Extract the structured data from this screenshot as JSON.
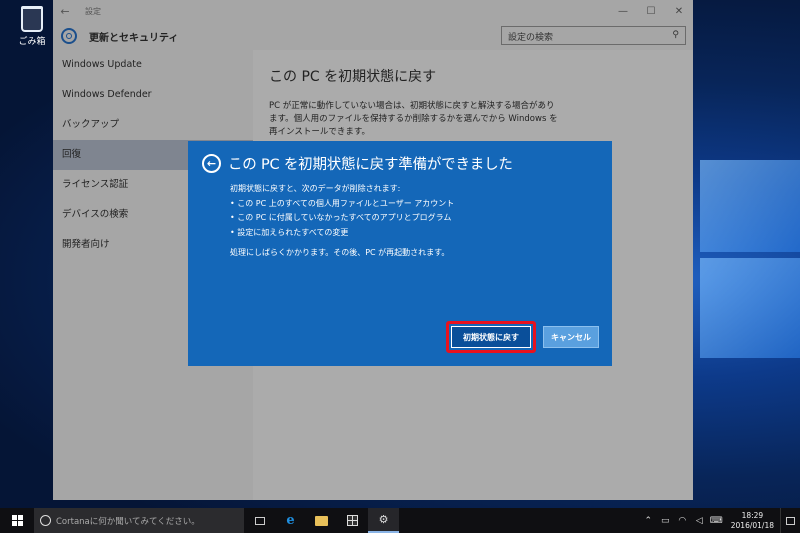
{
  "desktop": {
    "recycle_bin_label": "ごみ箱"
  },
  "settings_window": {
    "title": "設定",
    "back_glyph": "←",
    "min_glyph": "—",
    "max_glyph": "☐",
    "close_glyph": "✕",
    "header_title": "更新とセキュリティ",
    "search_placeholder": "設定の検索",
    "search_icon_glyph": "⚲",
    "sidebar": {
      "items": [
        {
          "label": "Windows Update"
        },
        {
          "label": "Windows Defender"
        },
        {
          "label": "バックアップ"
        },
        {
          "label": "回復"
        },
        {
          "label": "ライセンス認証"
        },
        {
          "label": "デバイスの検索"
        },
        {
          "label": "開発者向け"
        }
      ]
    },
    "content": {
      "title": "この PC を初期状態に戻す",
      "description": "PC が正常に動作していない場合は、初期状態に戻すと解決する場合があります。個人用のファイルを保持するか削除するかを選んでから Windows を再インストールできます。"
    }
  },
  "dialog": {
    "back_glyph": "←",
    "title": "この PC を初期状態に戻す準備ができました",
    "intro": "初期状態に戻すと、次のデータが削除されます:",
    "bullets": [
      "この PC 上のすべての個人用ファイルとユーザー アカウント",
      "この PC に付属していなかったすべてのアプリとプログラム",
      "設定に加えられたすべての変更"
    ],
    "note": "処理にしばらくかかります。その後、PC が再起動されます。",
    "reset_button": "初期状態に戻す",
    "cancel_button": "キャンセル",
    "highlight_color": "#e8121f"
  },
  "taskbar": {
    "cortana_placeholder": "Cortanaに何か聞いてみてください。",
    "edge_glyph": "e",
    "settings_glyph": "⚙",
    "tray_up_glyph": "⌃",
    "tray_battery_glyph": "▭",
    "tray_wifi_glyph": "◠",
    "tray_volume_glyph": "◁",
    "tray_keyboard_glyph": "⌨",
    "time": "18:29",
    "date": "2016/01/18"
  },
  "colors": {
    "dialog_blue": "#1467b8",
    "accent": "#1f8fe0"
  }
}
